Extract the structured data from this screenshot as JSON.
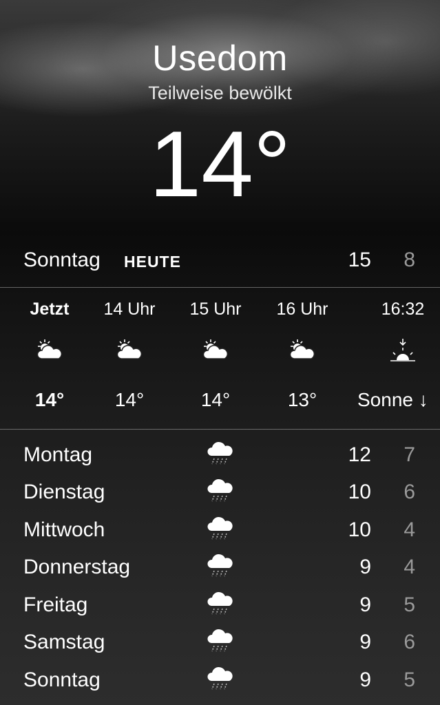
{
  "location": {
    "city": "Usedom",
    "condition": "Teilweise bewölkt",
    "temperature": "14°"
  },
  "today": {
    "day": "Sonntag",
    "badge": "HEUTE",
    "high": "15",
    "low": "8"
  },
  "hourly": [
    {
      "time": "Jetzt",
      "icon": "partly-cloudy-icon",
      "temp": "14°"
    },
    {
      "time": "14 Uhr",
      "icon": "partly-cloudy-icon",
      "temp": "14°"
    },
    {
      "time": "15 Uhr",
      "icon": "partly-cloudy-icon",
      "temp": "14°"
    },
    {
      "time": "16 Uhr",
      "icon": "partly-cloudy-icon",
      "temp": "13°"
    },
    {
      "time": "16:32",
      "icon": "sunset-icon",
      "temp": "Sonne ↓"
    }
  ],
  "daily": [
    {
      "day": "Montag",
      "icon": "rain-cloud-icon",
      "high": "12",
      "low": "7"
    },
    {
      "day": "Dienstag",
      "icon": "rain-cloud-icon",
      "high": "10",
      "low": "6"
    },
    {
      "day": "Mittwoch",
      "icon": "rain-cloud-icon",
      "high": "10",
      "low": "4"
    },
    {
      "day": "Donnerstag",
      "icon": "rain-cloud-icon",
      "high": "9",
      "low": "4"
    },
    {
      "day": "Freitag",
      "icon": "rain-cloud-icon",
      "high": "9",
      "low": "5"
    },
    {
      "day": "Samstag",
      "icon": "rain-cloud-icon",
      "high": "9",
      "low": "6"
    },
    {
      "day": "Sonntag",
      "icon": "rain-cloud-icon",
      "high": "9",
      "low": "5"
    }
  ]
}
